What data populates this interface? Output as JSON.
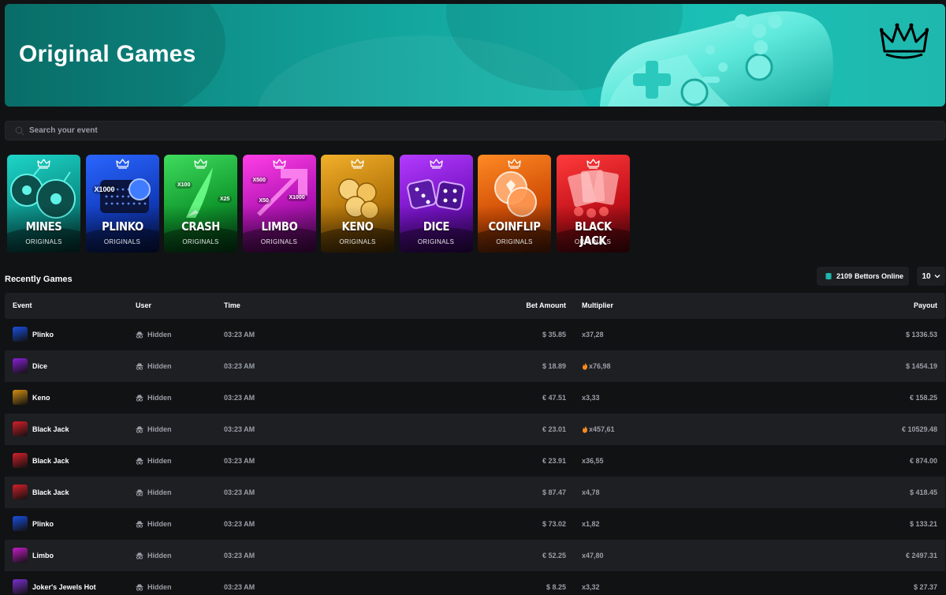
{
  "banner": {
    "title": "Original Games"
  },
  "search": {
    "placeholder": "Search your event"
  },
  "cards": [
    {
      "name": "MINES",
      "sub": "ORIGINALS",
      "theme": "c-mines"
    },
    {
      "name": "PLINKO",
      "sub": "ORIGINALS",
      "theme": "c-plinko",
      "badge": "X1000"
    },
    {
      "name": "CRASH",
      "sub": "ORIGINALS",
      "theme": "c-crash",
      "badge": "X100",
      "badge2": "X25"
    },
    {
      "name": "LIMBO",
      "sub": "ORIGINALS",
      "theme": "c-limbo",
      "badge": "X500",
      "badge2": "X1000",
      "badge3": "X50"
    },
    {
      "name": "KENO",
      "sub": "ORIGINALS",
      "theme": "c-keno"
    },
    {
      "name": "DICE",
      "sub": "ORIGINALS",
      "theme": "c-dice"
    },
    {
      "name": "COINFLIP",
      "sub": "ORIGINALS",
      "theme": "c-coinflip"
    },
    {
      "name": "BLACK JACK",
      "sub": "ORIGINALS",
      "theme": "c-blackjack"
    }
  ],
  "recent": {
    "title": "Recently Games",
    "bettors_count": "2109",
    "bettors_label": "Bettors Online",
    "page_size": "10"
  },
  "table": {
    "headers": {
      "event": "Event",
      "user": "User",
      "time": "Time",
      "bet": "Bet Amount",
      "multiplier": "Multiplier",
      "payout": "Payout"
    },
    "rows": [
      {
        "event": "Plinko",
        "user": "Hidden",
        "time": "03:23 AM",
        "bet": "$ 35.85",
        "multiplier": "x37,28",
        "hot": false,
        "payout": "$ 1336.53",
        "thumb": "#1a4fe0"
      },
      {
        "event": "Dice",
        "user": "Hidden",
        "time": "03:23 AM",
        "bet": "$ 18.89",
        "multiplier": "x76,98",
        "hot": true,
        "payout": "$ 1454.19",
        "thumb": "#8a1fd6"
      },
      {
        "event": "Keno",
        "user": "Hidden",
        "time": "03:23 AM",
        "bet": "€ 47.51",
        "multiplier": "x3,33",
        "hot": false,
        "payout": "€ 158.25",
        "thumb": "#d18d13"
      },
      {
        "event": "Black Jack",
        "user": "Hidden",
        "time": "03:23 AM",
        "bet": "€ 23.01",
        "multiplier": "x457,61",
        "hot": true,
        "payout": "€ 10529.48",
        "thumb": "#d41f2a"
      },
      {
        "event": "Black Jack",
        "user": "Hidden",
        "time": "03:23 AM",
        "bet": "€ 23.91",
        "multiplier": "x36,55",
        "hot": false,
        "payout": "€ 874.00",
        "thumb": "#d41f2a"
      },
      {
        "event": "Black Jack",
        "user": "Hidden",
        "time": "03:23 AM",
        "bet": "$ 87.47",
        "multiplier": "x4,78",
        "hot": false,
        "payout": "$ 418.45",
        "thumb": "#d41f2a"
      },
      {
        "event": "Plinko",
        "user": "Hidden",
        "time": "03:23 AM",
        "bet": "$ 73.02",
        "multiplier": "x1,82",
        "hot": false,
        "payout": "$ 133.21",
        "thumb": "#1a4fe0"
      },
      {
        "event": "Limbo",
        "user": "Hidden",
        "time": "03:23 AM",
        "bet": "€ 52.25",
        "multiplier": "x47,80",
        "hot": false,
        "payout": "€ 2497.31",
        "thumb": "#c41cc7"
      },
      {
        "event": "Joker's Jewels Hot",
        "user": "Hidden",
        "time": "03:23 AM",
        "bet": "$ 8.25",
        "multiplier": "x3,32",
        "hot": false,
        "payout": "$ 27.37",
        "thumb": "#7b2fd0"
      }
    ]
  },
  "colors": {
    "bg": "#111214",
    "panel": "#1d1f23",
    "accent": "#1fb8ae",
    "muted": "#9a9ea6",
    "fire": "#ff8a1f"
  }
}
